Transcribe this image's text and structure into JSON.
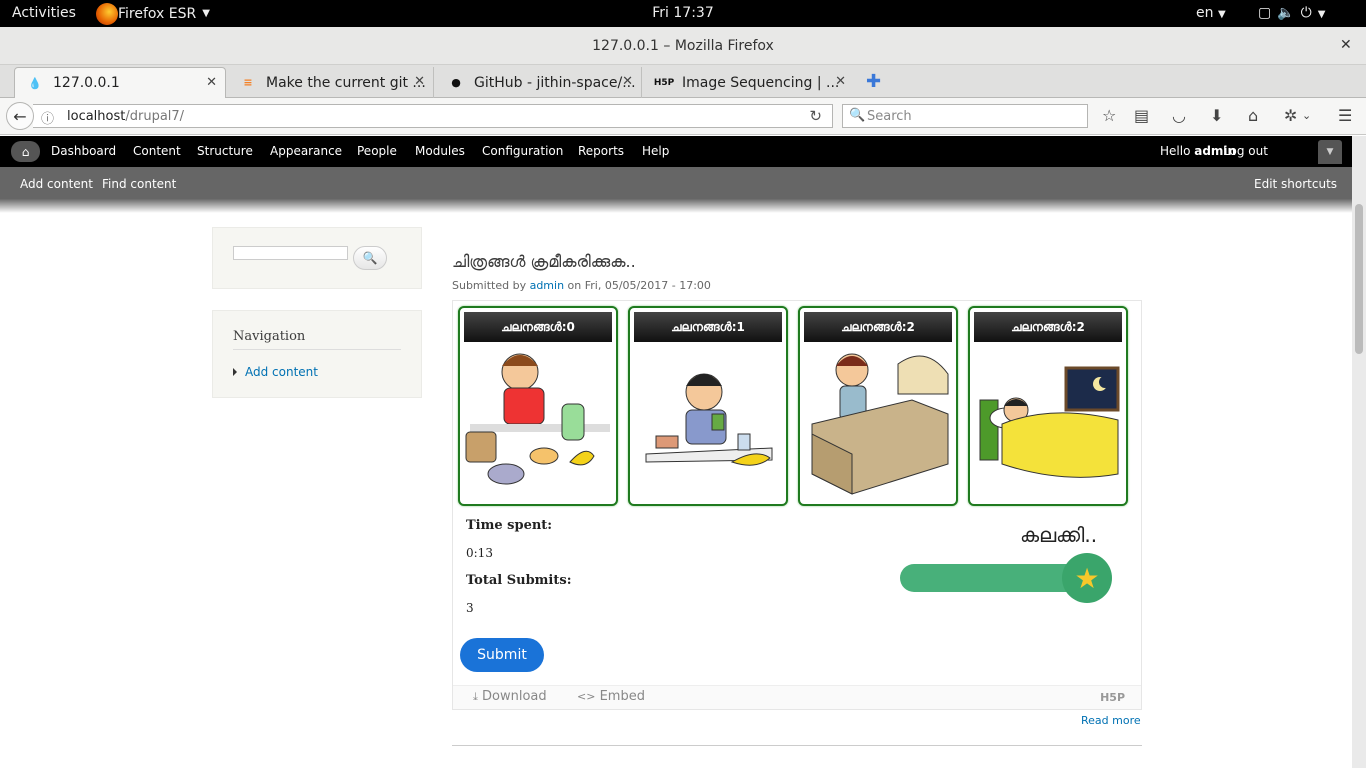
{
  "os_bar": {
    "activities": "Activities",
    "app": "Firefox ESR",
    "clock": "Fri 17:37",
    "lang": "en"
  },
  "window": {
    "title": "127.0.0.1 – Mozilla Firefox"
  },
  "tabs": [
    {
      "label": "127.0.0.1"
    },
    {
      "label": "Make the current git ..."
    },
    {
      "label": "GitHub - jithin-space/..."
    },
    {
      "label": "Image Sequencing | ..."
    }
  ],
  "navbar": {
    "url_host": "localhost",
    "url_path": "/drupal7/",
    "search_placeholder": "Search"
  },
  "toolbar": {
    "menu": [
      "Dashboard",
      "Content",
      "Structure",
      "Appearance",
      "People",
      "Modules",
      "Configuration",
      "Reports",
      "Help"
    ],
    "hello": "Hello ",
    "user": "admin",
    "logout": "Log out"
  },
  "shortcuts": {
    "add_content": "Add content",
    "find_content": "Find content",
    "edit_shortcuts": "Edit shortcuts"
  },
  "sidebar": {
    "nav_title": "Navigation",
    "nav_item": "Add content"
  },
  "node": {
    "title": "ചിത്രങ്ങൾ ക്രമീകരിക്കുക..",
    "submitted_prefix": "Submitted by ",
    "author": "admin",
    "submitted_suffix": " on Fri, 05/05/2017 - 17:00",
    "read_more": "Read more"
  },
  "h5p": {
    "cards": [
      {
        "caption": "ചലനങ്ങൾ:0"
      },
      {
        "caption": "ചലനങ്ങൾ:1"
      },
      {
        "caption": "ചലനങ്ങൾ:2"
      },
      {
        "caption": "ചലനങ്ങൾ:2"
      }
    ],
    "time_label": "Time spent:",
    "time_value": "0:13",
    "submits_label": "Total Submits:",
    "submits_value": "3",
    "feedback": "കലക്കി..",
    "score_fraction": 1.0,
    "submit_label": "Submit",
    "download_label": "Download",
    "embed_label": "Embed",
    "h5p_logo": "H5P",
    "accent_color": "#1a73d8",
    "bar_color": "#48b07a"
  }
}
